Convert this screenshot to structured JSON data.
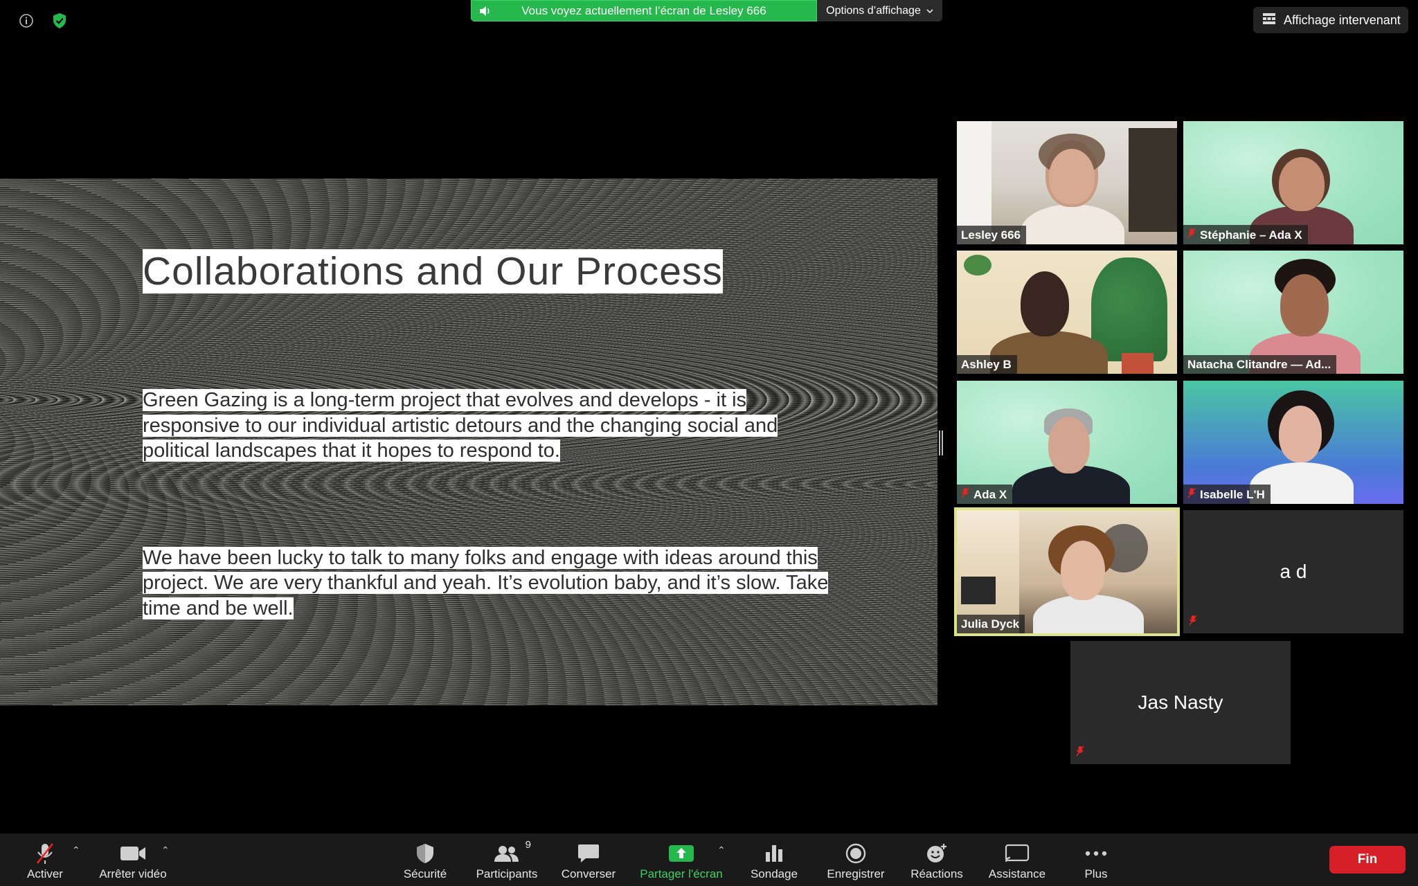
{
  "banner": {
    "share_text": "Vous voyez actuellement l’écran de Lesley 666",
    "options_label": "Options d’affichage"
  },
  "view_button": {
    "label": "Affichage intervenant"
  },
  "slide": {
    "title": "Collaborations and Our Process",
    "paragraph1": "Green Gazing is a long-term project that evolves and develops - it is responsive to our individual artistic detours and the changing social and political landscapes that it hopes to respond to.",
    "paragraph2": "We have been lucky to talk to many folks and engage with ideas around this project. We are very thankful and yeah. It’s evolution baby, and it’s slow. Take time and be well."
  },
  "participants": [
    {
      "name": "Lesley 666",
      "muted": false
    },
    {
      "name": "Stéphanie – Ada X",
      "muted": true
    },
    {
      "name": "Ashley B",
      "muted": false
    },
    {
      "name": "Natacha Clitandre — Ad...",
      "muted": false
    },
    {
      "name": "Ada X",
      "muted": true
    },
    {
      "name": "Isabelle L'H",
      "muted": true
    },
    {
      "name": "Julia Dyck",
      "muted": false,
      "active_speaker": true
    },
    {
      "name": "a d",
      "muted": true
    },
    {
      "name": "Jas Nasty",
      "muted": true
    }
  ],
  "toolbar": {
    "mute_label": "Activer",
    "video_label": "Arrêter vidéo",
    "security_label": "Sécurité",
    "participants_label": "Participants",
    "participants_count": "9",
    "chat_label": "Converser",
    "share_label": "Partager l'écran",
    "poll_label": "Sondage",
    "record_label": "Enregistrer",
    "reactions_label": "Réactions",
    "assist_label": "Assistance",
    "more_label": "Plus",
    "end_label": "Fin"
  },
  "colors": {
    "share_green": "#25b84c",
    "end_red": "#d61f26",
    "active_speaker_outline": "#dde38a"
  }
}
